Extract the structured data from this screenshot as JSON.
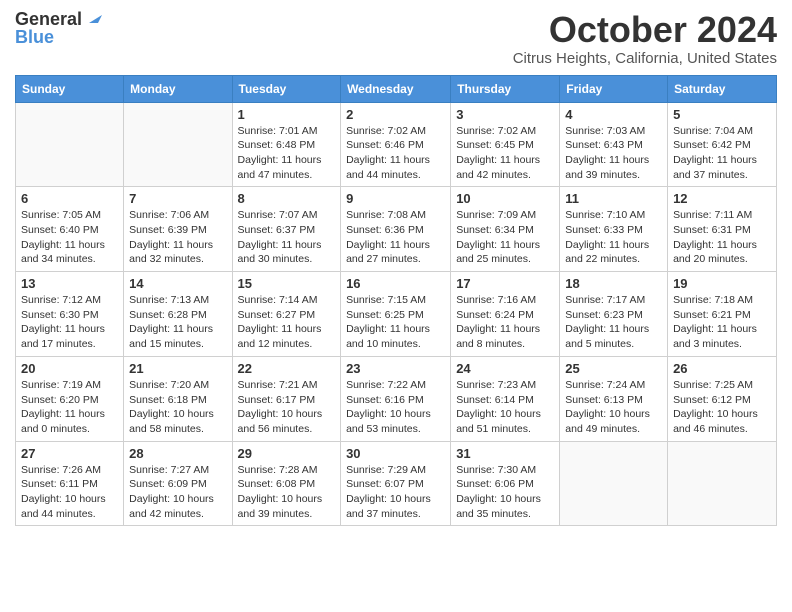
{
  "header": {
    "logo_general": "General",
    "logo_blue": "Blue",
    "month_title": "October 2024",
    "location": "Citrus Heights, California, United States"
  },
  "days_of_week": [
    "Sunday",
    "Monday",
    "Tuesday",
    "Wednesday",
    "Thursday",
    "Friday",
    "Saturday"
  ],
  "weeks": [
    [
      {
        "day": "",
        "info": ""
      },
      {
        "day": "",
        "info": ""
      },
      {
        "day": "1",
        "info": "Sunrise: 7:01 AM\nSunset: 6:48 PM\nDaylight: 11 hours and 47 minutes."
      },
      {
        "day": "2",
        "info": "Sunrise: 7:02 AM\nSunset: 6:46 PM\nDaylight: 11 hours and 44 minutes."
      },
      {
        "day": "3",
        "info": "Sunrise: 7:02 AM\nSunset: 6:45 PM\nDaylight: 11 hours and 42 minutes."
      },
      {
        "day": "4",
        "info": "Sunrise: 7:03 AM\nSunset: 6:43 PM\nDaylight: 11 hours and 39 minutes."
      },
      {
        "day": "5",
        "info": "Sunrise: 7:04 AM\nSunset: 6:42 PM\nDaylight: 11 hours and 37 minutes."
      }
    ],
    [
      {
        "day": "6",
        "info": "Sunrise: 7:05 AM\nSunset: 6:40 PM\nDaylight: 11 hours and 34 minutes."
      },
      {
        "day": "7",
        "info": "Sunrise: 7:06 AM\nSunset: 6:39 PM\nDaylight: 11 hours and 32 minutes."
      },
      {
        "day": "8",
        "info": "Sunrise: 7:07 AM\nSunset: 6:37 PM\nDaylight: 11 hours and 30 minutes."
      },
      {
        "day": "9",
        "info": "Sunrise: 7:08 AM\nSunset: 6:36 PM\nDaylight: 11 hours and 27 minutes."
      },
      {
        "day": "10",
        "info": "Sunrise: 7:09 AM\nSunset: 6:34 PM\nDaylight: 11 hours and 25 minutes."
      },
      {
        "day": "11",
        "info": "Sunrise: 7:10 AM\nSunset: 6:33 PM\nDaylight: 11 hours and 22 minutes."
      },
      {
        "day": "12",
        "info": "Sunrise: 7:11 AM\nSunset: 6:31 PM\nDaylight: 11 hours and 20 minutes."
      }
    ],
    [
      {
        "day": "13",
        "info": "Sunrise: 7:12 AM\nSunset: 6:30 PM\nDaylight: 11 hours and 17 minutes."
      },
      {
        "day": "14",
        "info": "Sunrise: 7:13 AM\nSunset: 6:28 PM\nDaylight: 11 hours and 15 minutes."
      },
      {
        "day": "15",
        "info": "Sunrise: 7:14 AM\nSunset: 6:27 PM\nDaylight: 11 hours and 12 minutes."
      },
      {
        "day": "16",
        "info": "Sunrise: 7:15 AM\nSunset: 6:25 PM\nDaylight: 11 hours and 10 minutes."
      },
      {
        "day": "17",
        "info": "Sunrise: 7:16 AM\nSunset: 6:24 PM\nDaylight: 11 hours and 8 minutes."
      },
      {
        "day": "18",
        "info": "Sunrise: 7:17 AM\nSunset: 6:23 PM\nDaylight: 11 hours and 5 minutes."
      },
      {
        "day": "19",
        "info": "Sunrise: 7:18 AM\nSunset: 6:21 PM\nDaylight: 11 hours and 3 minutes."
      }
    ],
    [
      {
        "day": "20",
        "info": "Sunrise: 7:19 AM\nSunset: 6:20 PM\nDaylight: 11 hours and 0 minutes."
      },
      {
        "day": "21",
        "info": "Sunrise: 7:20 AM\nSunset: 6:18 PM\nDaylight: 10 hours and 58 minutes."
      },
      {
        "day": "22",
        "info": "Sunrise: 7:21 AM\nSunset: 6:17 PM\nDaylight: 10 hours and 56 minutes."
      },
      {
        "day": "23",
        "info": "Sunrise: 7:22 AM\nSunset: 6:16 PM\nDaylight: 10 hours and 53 minutes."
      },
      {
        "day": "24",
        "info": "Sunrise: 7:23 AM\nSunset: 6:14 PM\nDaylight: 10 hours and 51 minutes."
      },
      {
        "day": "25",
        "info": "Sunrise: 7:24 AM\nSunset: 6:13 PM\nDaylight: 10 hours and 49 minutes."
      },
      {
        "day": "26",
        "info": "Sunrise: 7:25 AM\nSunset: 6:12 PM\nDaylight: 10 hours and 46 minutes."
      }
    ],
    [
      {
        "day": "27",
        "info": "Sunrise: 7:26 AM\nSunset: 6:11 PM\nDaylight: 10 hours and 44 minutes."
      },
      {
        "day": "28",
        "info": "Sunrise: 7:27 AM\nSunset: 6:09 PM\nDaylight: 10 hours and 42 minutes."
      },
      {
        "day": "29",
        "info": "Sunrise: 7:28 AM\nSunset: 6:08 PM\nDaylight: 10 hours and 39 minutes."
      },
      {
        "day": "30",
        "info": "Sunrise: 7:29 AM\nSunset: 6:07 PM\nDaylight: 10 hours and 37 minutes."
      },
      {
        "day": "31",
        "info": "Sunrise: 7:30 AM\nSunset: 6:06 PM\nDaylight: 10 hours and 35 minutes."
      },
      {
        "day": "",
        "info": ""
      },
      {
        "day": "",
        "info": ""
      }
    ]
  ]
}
